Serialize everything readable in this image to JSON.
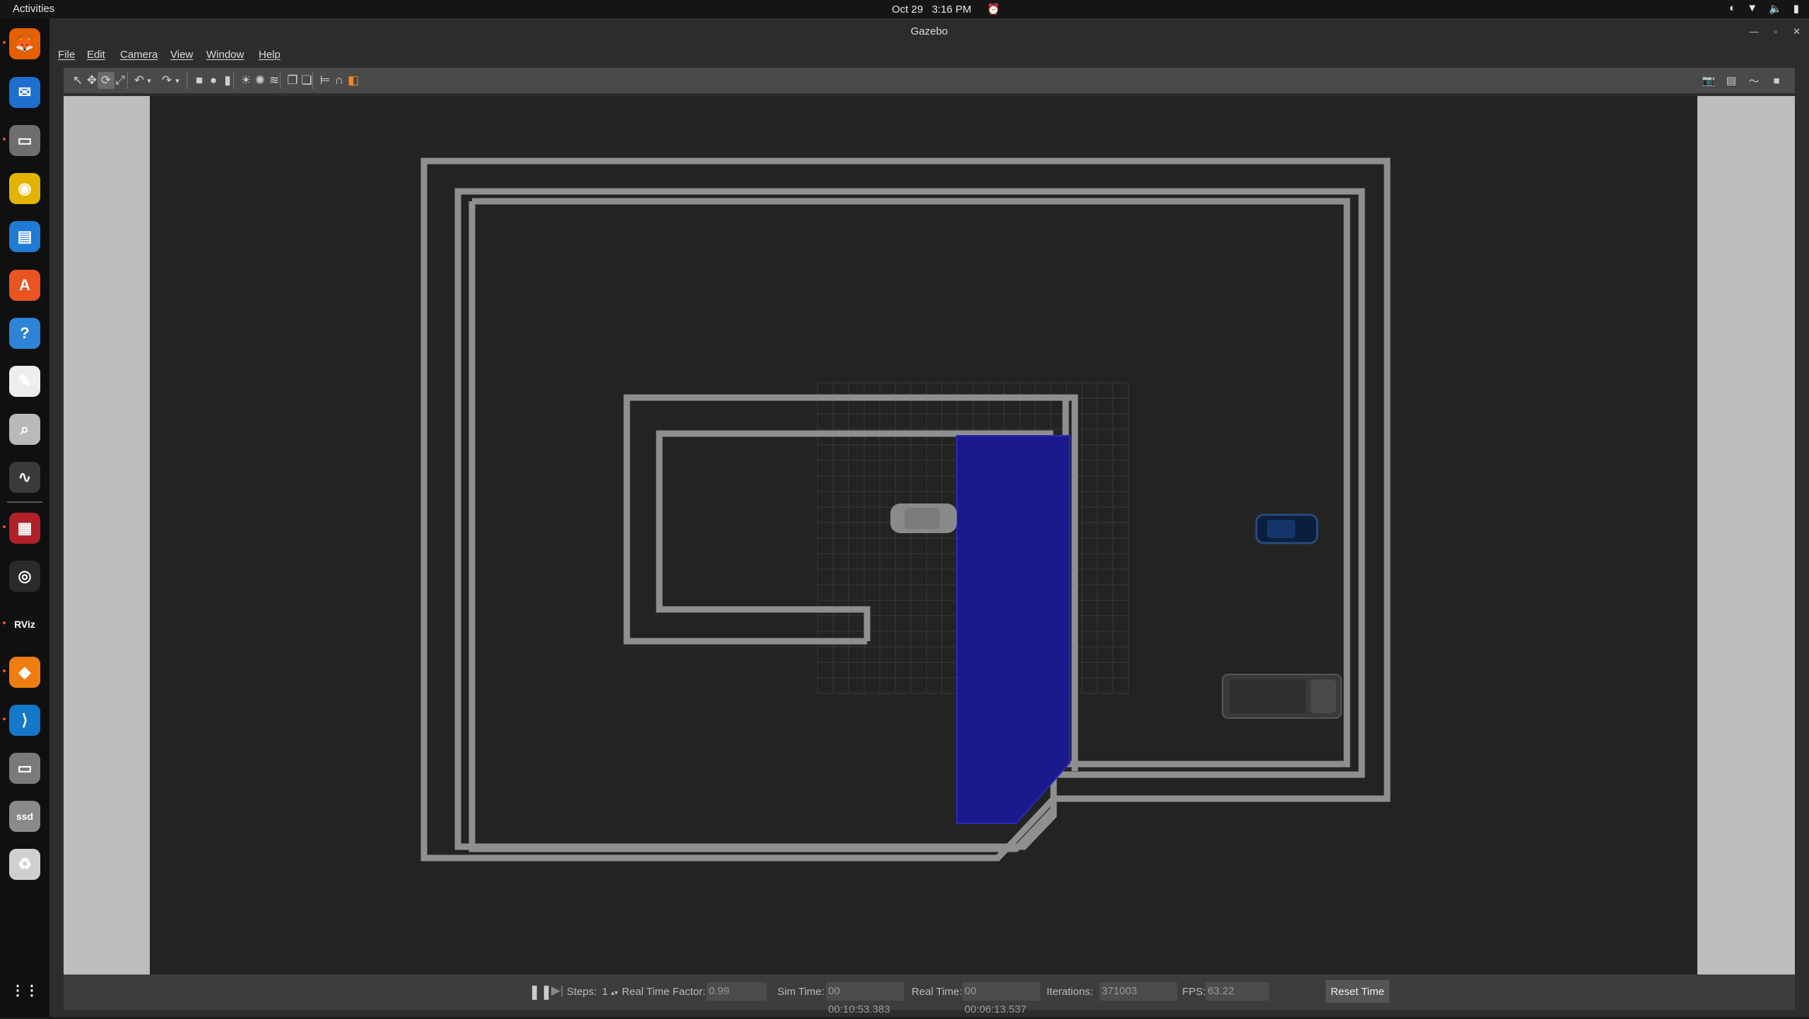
{
  "topbar": {
    "activities": "Activities",
    "date": "Oct 29",
    "time": "3:16 PM"
  },
  "dock": {
    "apps": [
      {
        "name": "firefox-icon",
        "glyph": "🦊",
        "color": "#e66000"
      },
      {
        "name": "thunderbird-icon",
        "glyph": "✉",
        "color": "#1e6fcf"
      },
      {
        "name": "files-icon",
        "glyph": "▭",
        "color": "#6e6e6e"
      },
      {
        "name": "rhythmbox-icon",
        "glyph": "◉",
        "color": "#e2b400"
      },
      {
        "name": "writer-icon",
        "glyph": "▤",
        "color": "#1f7bd4"
      },
      {
        "name": "app-center-icon",
        "glyph": "A",
        "color": "#e95420"
      },
      {
        "name": "help-icon",
        "glyph": "?",
        "color": "#2d83d6"
      },
      {
        "name": "text-editor-icon",
        "glyph": "✎",
        "color": "#eeeeee"
      },
      {
        "name": "image-viewer-icon",
        "glyph": "⌕",
        "color": "#b9b9b9"
      },
      {
        "name": "system-monitor-icon",
        "glyph": "∿",
        "color": "#3a3a3a"
      },
      {
        "name": "terminal-red-icon",
        "glyph": "▦",
        "color": "#b2202a"
      },
      {
        "name": "obs-icon",
        "glyph": "◎",
        "color": "#2a2a2a"
      },
      {
        "name": "rviz-icon",
        "glyph": "RViz",
        "color": "#101010"
      },
      {
        "name": "gazebo-icon",
        "glyph": "◆",
        "color": "#f07d10"
      },
      {
        "name": "vscode-icon",
        "glyph": "⟩",
        "color": "#1577c9"
      },
      {
        "name": "drive-icon",
        "glyph": "▭",
        "color": "#7a7a7a"
      },
      {
        "name": "ssd-icon",
        "glyph": "ssd",
        "color": "#8a8a8a"
      },
      {
        "name": "trash-icon",
        "glyph": "♻",
        "color": "#cfcfcf"
      }
    ],
    "apps_grid_glyph": "⋮⋮"
  },
  "window": {
    "title": "Gazebo"
  },
  "menu": [
    "File",
    "Edit",
    "Camera",
    "View",
    "Window",
    "Help"
  ],
  "toolbar": {
    "tools": [
      {
        "name": "select-mode-icon",
        "glyph": "↖"
      },
      {
        "name": "translate-mode-icon",
        "glyph": "✥"
      },
      {
        "name": "rotate-mode-icon",
        "glyph": "⟳",
        "active": true
      },
      {
        "name": "scale-mode-icon",
        "glyph": "⤢"
      },
      {
        "name": "undo-icon",
        "glyph": "↶"
      },
      {
        "name": "undo-history-icon",
        "glyph": "▾"
      },
      {
        "name": "redo-icon",
        "glyph": "↷"
      },
      {
        "name": "redo-history-icon",
        "glyph": "▾"
      },
      {
        "name": "box-shape-icon",
        "glyph": "■"
      },
      {
        "name": "sphere-shape-icon",
        "glyph": "●"
      },
      {
        "name": "cylinder-shape-icon",
        "glyph": "▮"
      },
      {
        "name": "point-light-icon",
        "glyph": "☀"
      },
      {
        "name": "spot-light-icon",
        "glyph": "✺"
      },
      {
        "name": "directional-light-icon",
        "glyph": "≋"
      },
      {
        "name": "copy-icon",
        "glyph": "❐"
      },
      {
        "name": "paste-icon",
        "glyph": "❏"
      },
      {
        "name": "align-icon",
        "glyph": "⊨"
      },
      {
        "name": "snap-icon",
        "glyph": "∩"
      },
      {
        "name": "view-angle-icon",
        "glyph": "◧"
      }
    ],
    "right_tools": [
      {
        "name": "screenshot-icon",
        "glyph": "📷"
      },
      {
        "name": "log-icon",
        "glyph": "▤"
      },
      {
        "name": "plot-icon",
        "glyph": "〜"
      },
      {
        "name": "video-record-icon",
        "glyph": "■"
      }
    ]
  },
  "colors": {
    "floor": "#232323",
    "track": "#8f8f8f",
    "water": "#1a1a8e",
    "side_panel": "#bdbdbd"
  },
  "bottombar": {
    "steps_label": "Steps:",
    "steps_value": "1",
    "rtf_label": "Real Time Factor:",
    "rtf_value": "0.99",
    "sim_time_label": "Sim Time:",
    "sim_time_value": "00 00:10:53.383",
    "real_time_label": "Real Time:",
    "real_time_value": "00 00:06:13.537",
    "iterations_label": "Iterations:",
    "iterations_value": "371003",
    "fps_label": "FPS:",
    "fps_value": "63.22",
    "reset_label": "Reset Time"
  }
}
